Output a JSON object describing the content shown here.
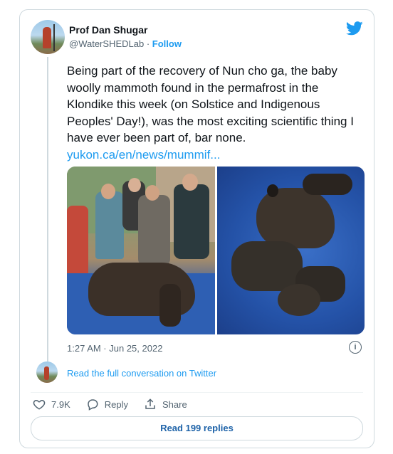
{
  "author": {
    "name": "Prof Dan Shugar",
    "handle": "@WaterSHEDLab",
    "separator": "·",
    "follow_label": "Follow"
  },
  "tweet": {
    "text": "Being part of the recovery of Nun cho ga, the baby woolly mammoth found in the permafrost in the Klondike this week (on Solstice and Indigenous Peoples' Day!), was the most exciting scientific thing I have ever been part of, bar none.",
    "link": "yukon.ca/en/news/mummif...",
    "timestamp": "1:27 AM · Jun 25, 2022"
  },
  "thread": {
    "read_conversation": "Read the full conversation on Twitter"
  },
  "actions": {
    "like_count": "7.9K",
    "reply_label": "Reply",
    "share_label": "Share"
  },
  "replies_button": "Read 199 replies",
  "info_glyph": "i",
  "colors": {
    "link": "#1d9bf0",
    "replies_text": "#1d62a8",
    "border": "#cfd9de",
    "muted": "#536471"
  },
  "icons": [
    "twitter-bird-icon",
    "info-icon",
    "heart-icon",
    "reply-icon",
    "share-icon"
  ]
}
